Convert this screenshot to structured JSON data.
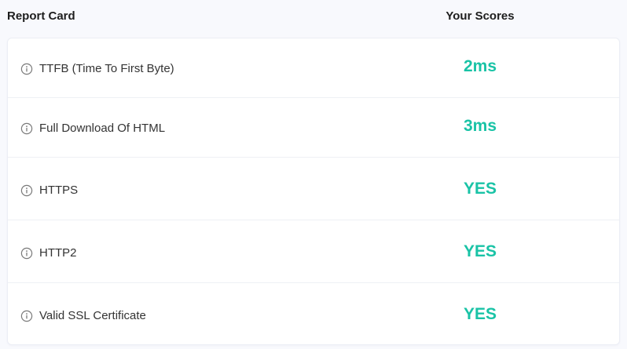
{
  "header": {
    "left_title": "Report Card",
    "right_title": "Your Scores"
  },
  "colors": {
    "score": "#19c3a6",
    "background": "#f8f9fd",
    "card": "#ffffff"
  },
  "icons": {
    "row_icon": "info-icon"
  },
  "rows": [
    {
      "label": "TTFB (Time To First Byte)",
      "score": "2ms"
    },
    {
      "label": "Full Download Of HTML",
      "score": "3ms"
    },
    {
      "label": "HTTPS",
      "score": "YES"
    },
    {
      "label": "HTTP2",
      "score": "YES"
    },
    {
      "label": "Valid SSL Certificate",
      "score": "YES"
    }
  ]
}
